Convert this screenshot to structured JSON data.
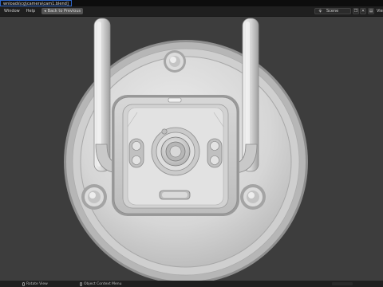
{
  "window": {
    "title": "wnloads\\cg\\camera\\cam1.blend]"
  },
  "topbar": {
    "menu": [
      "Window",
      "Help"
    ],
    "back_button_label": "Back to Previous",
    "scene_label": "Scene",
    "view_layer_label": "Vie"
  },
  "statusbar": {
    "left_hint": "Rotate View",
    "mid_hint": "Object Context Menu"
  },
  "colors": {
    "viewport_bg": "#3d3d3d",
    "topbar_bg": "#1f1f1f",
    "titlebar_bg": "#0d0d0d",
    "model_light": "#e6e6e6",
    "model_mid": "#c9c9c9",
    "model_dark": "#8e8e8e",
    "accent_title_border": "#2f66c7"
  },
  "icons": {
    "back": "back-arrow-icon",
    "scene": "scene-icon",
    "copy": "duplicate-icon",
    "delete": "close-icon",
    "mouse": "mouse-icon"
  }
}
